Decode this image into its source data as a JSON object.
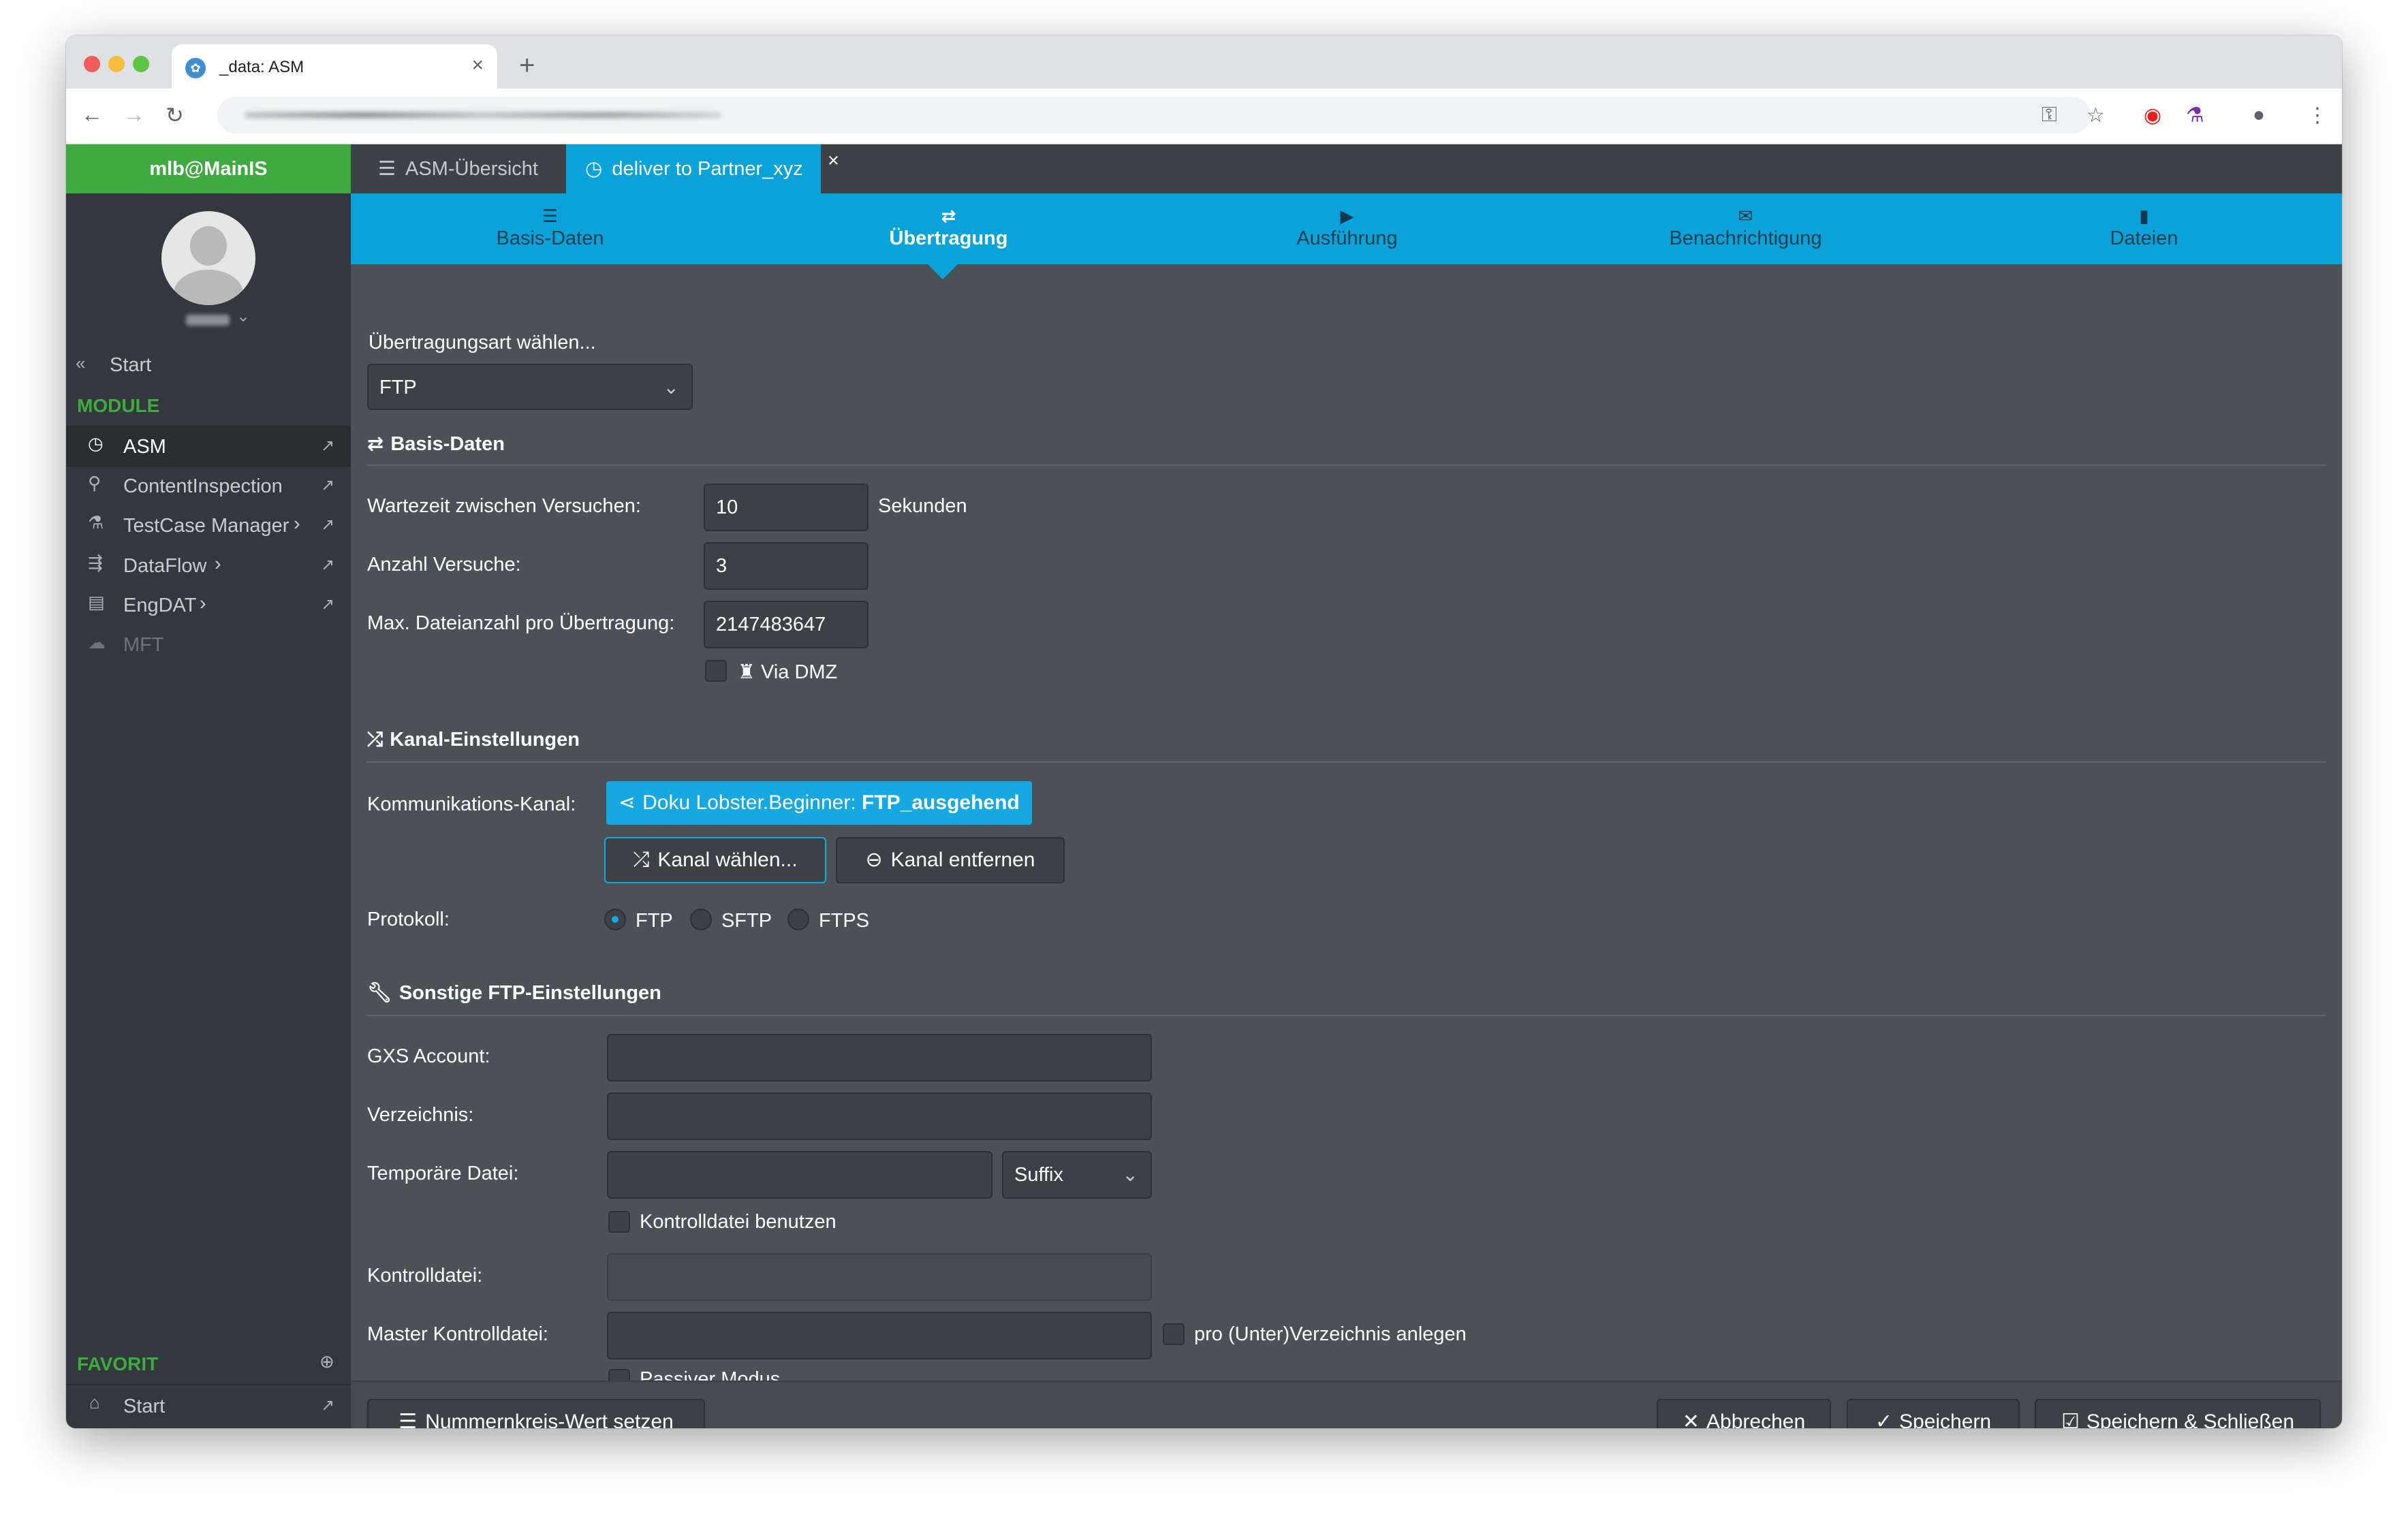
{
  "browser": {
    "tab_title": "_data: ASM",
    "tab_close": "×",
    "new_tab": "+"
  },
  "sidebar": {
    "user_header": "mlb@MainIS",
    "start_link": "Start",
    "module_heading": "MODULE",
    "modules": [
      {
        "label": "ASM",
        "icon": "clock-icon"
      },
      {
        "label": "ContentInspection",
        "icon": "magnifier-icon"
      },
      {
        "label": "TestCase Manager",
        "icon": "flask-icon"
      },
      {
        "label": "DataFlow",
        "icon": "flow-icon"
      },
      {
        "label": "EngDAT",
        "icon": "document-icon"
      },
      {
        "label": "MFT",
        "icon": "cloud-icon"
      }
    ],
    "favorite_heading": "FAVORIT",
    "favorites": [
      {
        "label": "Start",
        "icon": "home-icon"
      }
    ]
  },
  "app_tabs": {
    "overview": "ASM-Übersicht",
    "current": "deliver to Partner_xyz",
    "close": "×"
  },
  "wizard": {
    "steps": [
      {
        "label": "Basis-Daten",
        "icon": "list-icon"
      },
      {
        "label": "Übertragung",
        "icon": "exchange-icon",
        "active": true
      },
      {
        "label": "Ausführung",
        "icon": "play-icon"
      },
      {
        "label": "Benachrichtigung",
        "icon": "envelope-icon"
      },
      {
        "label": "Dateien",
        "icon": "file-icon"
      }
    ]
  },
  "form": {
    "transfer_type_label": "Übertragungsart wählen...",
    "transfer_type_value": "FTP",
    "basis_section": "Basis-Daten",
    "wait_label": "Wartezeit zwischen Versuchen:",
    "wait_value": "10",
    "wait_unit": "Sekunden",
    "attempts_label": "Anzahl Versuche:",
    "attempts_value": "3",
    "max_files_label": "Max. Dateianzahl pro Übertragung:",
    "max_files_value": "2147483647",
    "via_dmz_label": "Via DMZ",
    "channel_section": "Kanal-Einstellungen",
    "comm_channel_label": "Kommunikations-Kanal:",
    "channel_chip_prefix": "Doku Lobster.Beginner:",
    "channel_chip_name": "FTP_ausgehend",
    "choose_channel_button": "Kanal wählen...",
    "remove_channel_button": "Kanal entfernen",
    "protocol_label": "Protokoll:",
    "protocols": [
      "FTP",
      "SFTP",
      "FTPS"
    ],
    "protocol_selected": "FTP",
    "other_section": "Sonstige FTP-Einstellungen",
    "gxs_label": "GXS Account:",
    "gxs_value": "",
    "dir_label": "Verzeichnis:",
    "dir_value": "",
    "temp_label": "Temporäre Datei:",
    "temp_value": "",
    "temp_mode": "Suffix",
    "use_control_file_label": "Kontrolldatei benutzen",
    "control_file_label": "Kontrolldatei:",
    "control_file_value": "",
    "master_control_label": "Master Kontrolldatei:",
    "master_control_value": "",
    "per_dir_label": "pro (Unter)Verzeichnis anlegen",
    "passive_label": "Passiver Modus"
  },
  "footer": {
    "number_range_button": "Nummernkreis-Wert setzen",
    "cancel_button": "Abbrechen",
    "save_button": "Speichern",
    "save_close_button": "Speichern & Schließen"
  },
  "colors": {
    "accent": "#0aa3d9",
    "sidebar_header": "#3faa3f",
    "background": "#4b5257"
  }
}
